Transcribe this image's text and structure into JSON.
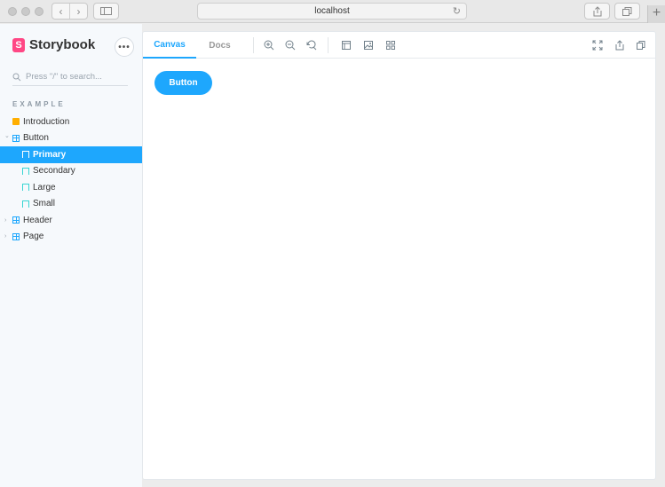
{
  "browser": {
    "url": "localhost"
  },
  "sidebar": {
    "brand": "Storybook",
    "brand_mark": "S",
    "menu_label": "•••",
    "search_placeholder": "Press \"/\" to search...",
    "section_title": "EXAMPLE",
    "items": [
      {
        "label": "Introduction",
        "icon": "document-icon",
        "level": 0,
        "expanded": false,
        "selected": false
      },
      {
        "label": "Button",
        "icon": "component-icon",
        "level": 0,
        "expanded": true,
        "selected": false
      },
      {
        "label": "Primary",
        "icon": "bookmark-icon",
        "level": 1,
        "selected": true
      },
      {
        "label": "Secondary",
        "icon": "bookmark-icon",
        "level": 1,
        "selected": false
      },
      {
        "label": "Large",
        "icon": "bookmark-icon",
        "level": 1,
        "selected": false
      },
      {
        "label": "Small",
        "icon": "bookmark-icon",
        "level": 1,
        "selected": false
      },
      {
        "label": "Header",
        "icon": "component-icon",
        "level": 0,
        "expanded": false,
        "selected": false
      },
      {
        "label": "Page",
        "icon": "component-icon",
        "level": 0,
        "expanded": false,
        "selected": false
      }
    ]
  },
  "toolbar": {
    "tabs": [
      {
        "label": "Canvas",
        "active": true
      },
      {
        "label": "Docs",
        "active": false
      }
    ]
  },
  "canvas": {
    "button_label": "Button"
  },
  "colors": {
    "accent": "#1ea7fd",
    "brand": "#ff4785",
    "sidebar_bg": "#f6f9fc"
  }
}
